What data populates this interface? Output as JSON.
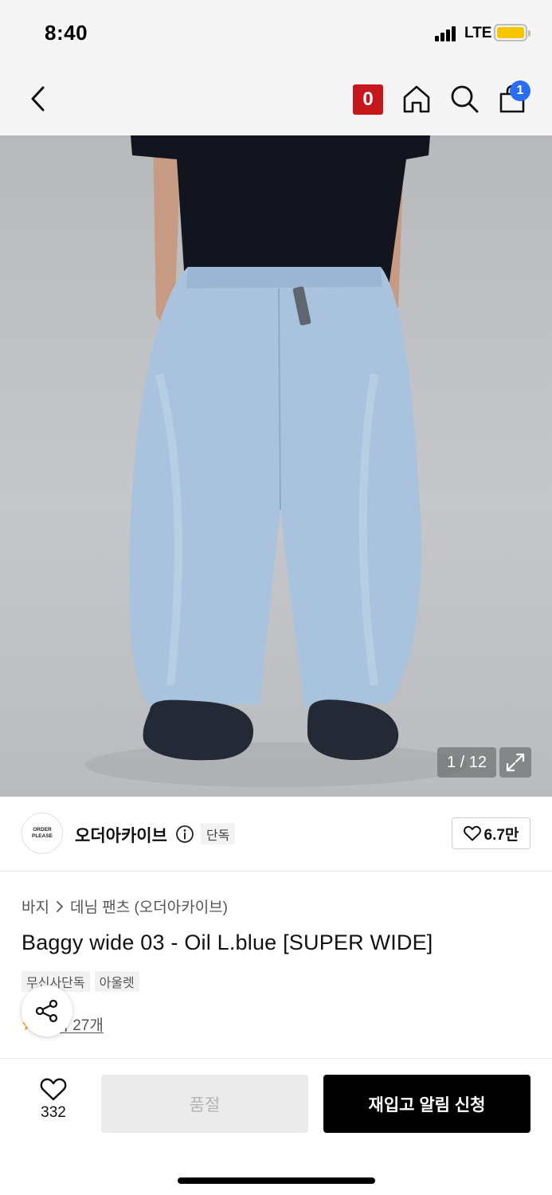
{
  "status_bar": {
    "time": "8:40",
    "network": "LTE"
  },
  "nav": {
    "icons": [
      "back-icon",
      "home-icon",
      "search-icon",
      "shopping-bag-icon"
    ],
    "zero_badge": "0",
    "cart_count": "1"
  },
  "gallery": {
    "counter": "1 / 12",
    "expand_icon": "expand-icon"
  },
  "brand": {
    "logo_text_line1": "ORDER",
    "logo_text_line2": "PLEASE",
    "name": "오더아카이브",
    "exclusive_tag": "단독",
    "like_count": "6.7만"
  },
  "product": {
    "breadcrumb_category": "바지",
    "breadcrumb_sub": "데님 팬츠 (오더아카이브)",
    "title": "Baggy wide 03 - Oil L.blue [SUPER WIDE]",
    "tags": [
      "무신사단독",
      "아울렛"
    ],
    "reviews_label": "후기 27개"
  },
  "bottom_bar": {
    "wish_count": "332",
    "soldout_label": "품절",
    "restock_label": "재입고 알림 신청"
  },
  "colors": {
    "accent_red": "#c8161d",
    "badge_blue": "#2a6df4",
    "primary_button": "#000000"
  }
}
